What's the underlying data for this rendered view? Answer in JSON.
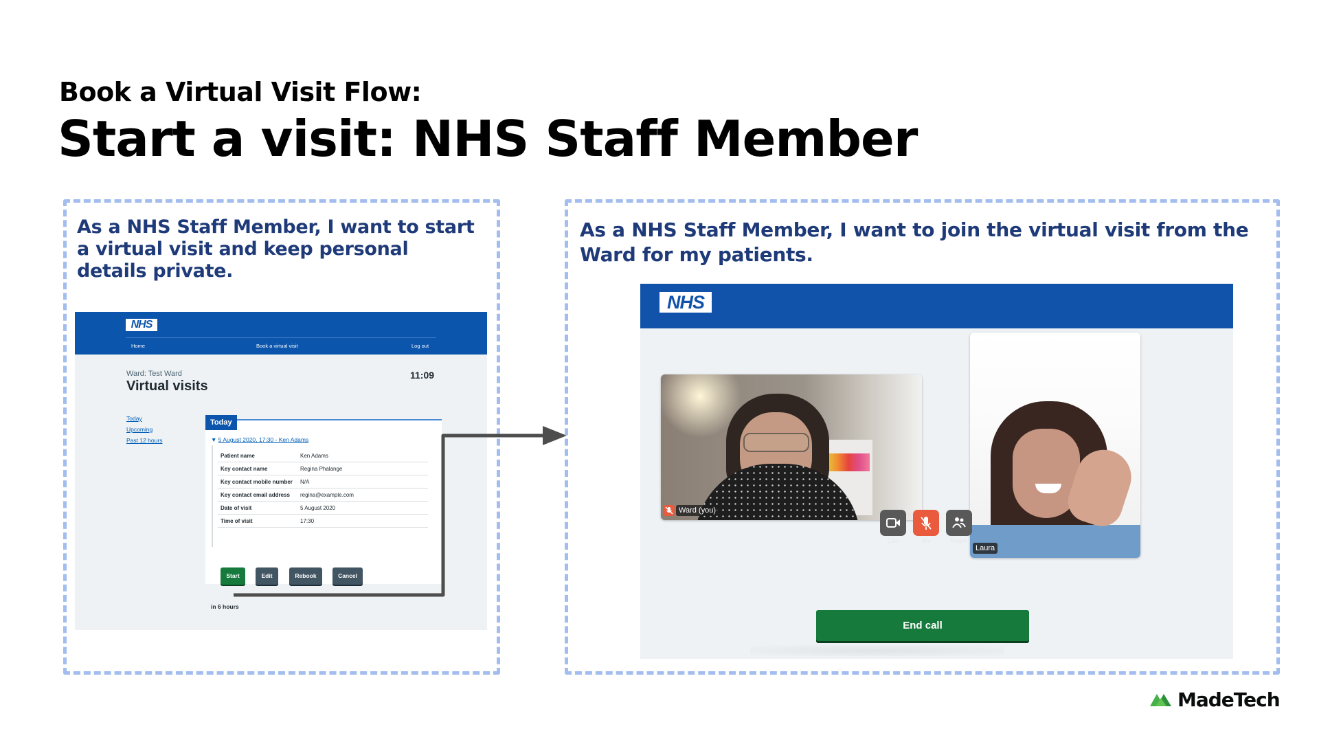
{
  "header": {
    "subtitle": "Book a Virtual Visit Flow:",
    "title": "Start a visit: NHS Staff Member"
  },
  "left_panel": {
    "story": "As a NHS Staff Member, I want to start a virtual visit and keep personal details private.",
    "screenshot": {
      "logo": "NHS",
      "nav": [
        "Home",
        "Book a virtual visit",
        "Log out"
      ],
      "ward_label": "Ward: Test Ward",
      "page_title": "Virtual visits",
      "clock": "11:09",
      "side_links": [
        "Today",
        "Upcoming",
        "Past 12 hours"
      ],
      "tab_label": "Today",
      "visit_summary": "5 August 2020, 17:30 - Ken Adams",
      "details": [
        {
          "key": "Patient name",
          "value": "Ken Adams"
        },
        {
          "key": "Key contact name",
          "value": "Regina Phalange"
        },
        {
          "key": "Key contact mobile number",
          "value": "N/A"
        },
        {
          "key": "Key contact email address",
          "value": "regina@example.com"
        },
        {
          "key": "Date of visit",
          "value": "5 August 2020"
        },
        {
          "key": "Time of visit",
          "value": "17:30"
        }
      ],
      "buttons": {
        "start": "Start",
        "edit": "Edit",
        "rebook": "Rebook",
        "cancel": "Cancel"
      },
      "time_until": "in 6 hours"
    }
  },
  "right_panel": {
    "story": "As a NHS Staff Member, I want to join the virtual visit from the Ward for my patients.",
    "screenshot": {
      "logo": "NHS",
      "participants": [
        {
          "name": "Ward (you)",
          "muted": true
        },
        {
          "name": "Laura",
          "muted": false
        }
      ],
      "controls": {
        "cam": "Cam",
        "mic": "Mic",
        "people": "People"
      },
      "end_call": "End call"
    }
  },
  "brand": {
    "name": "MadeTech",
    "colors": {
      "nhs_blue": "#0b55ad",
      "story_text": "#1e3a78",
      "dashed_border": "#a2bdee",
      "start_green": "#157a3c",
      "secondary_button": "#425563",
      "mute_red": "#ea5a3c",
      "control_grey": "#595959"
    }
  }
}
